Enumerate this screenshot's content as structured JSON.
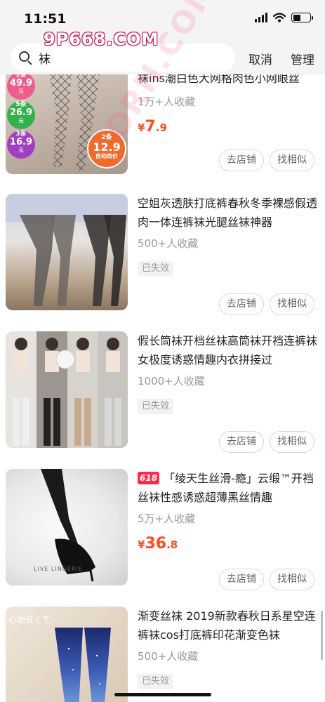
{
  "status": {
    "time": "11:51"
  },
  "watermark": {
    "top": "9P668.COM",
    "diagonal": "ORN.COM"
  },
  "search": {
    "query": "袜"
  },
  "nav": {
    "cancel": "取消",
    "manage": "管理"
  },
  "buttons": {
    "store": "去店铺",
    "similar": "找相似"
  },
  "items": [
    {
      "title": "袜ins潮白色大网格肉色小网眼丝",
      "fav": "1万+人收藏",
      "price_yen": "¥",
      "price_int": "7",
      "price_dec": ".9",
      "expired": "",
      "badges": [
        {
          "n": "1条",
          "p": "49.9",
          "u": "元"
        },
        {
          "n": "5条",
          "p": "26.9",
          "u": "元"
        },
        {
          "n": "3条",
          "p": "16.9",
          "u": "元"
        },
        {
          "n": "2条",
          "p": "12.9",
          "u": "元",
          "extra": "自动改价"
        }
      ]
    },
    {
      "title": "空姐灰透肤打底裤春秋冬季裸感假透肉一体连裤袜光腿丝袜神器",
      "fav": "500+人收藏",
      "expired": "已失效"
    },
    {
      "title": "假长筒袜开档丝袜高筒袜开裆连裤袜女极度诱惑情趣内衣拼接过",
      "fav": "1000+人收藏",
      "expired": "已失效"
    },
    {
      "tag": "618",
      "title": "「绫天生丝滑-瘾」云缎™开裆丝袜性感诱惑超薄黑丝情趣",
      "fav": "5万+人收藏",
      "price_yen": "¥",
      "price_int": "36",
      "price_dec": ".8",
      "thumb_text": "LIVE LINGERIE"
    },
    {
      "title": "渐变丝袜 2019新款春秋日系星空连裤袜cos打底裤印花渐变色袜",
      "fav": "500+人收藏",
      "expired": "已失效",
      "thumb_text": "心地良くて"
    }
  ],
  "colors": {
    "price": "#ff4d1a",
    "tag618": "#ff2b4a",
    "watermark": "#c21a57"
  }
}
